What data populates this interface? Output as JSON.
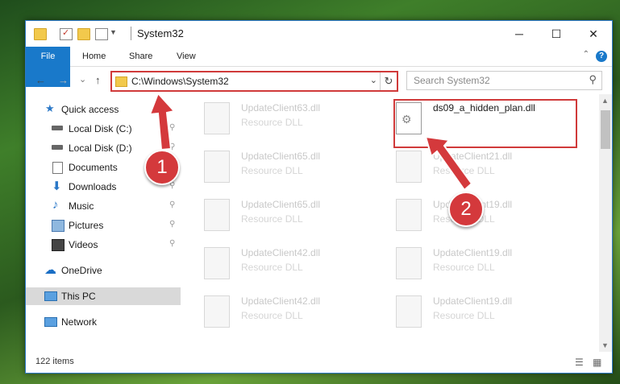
{
  "window": {
    "title": "System32",
    "minimize": "─",
    "maximize": "☐",
    "close": "✕"
  },
  "ribbon": {
    "tabs": [
      "File",
      "Home",
      "Share",
      "View"
    ],
    "help": "?",
    "collapse": "⌃"
  },
  "nav": {
    "back": "←",
    "forward": "→",
    "recent": "⌄",
    "up": "↑",
    "address": "C:\\Windows\\System32",
    "dropdown": "⌄",
    "refresh": "↻",
    "search_placeholder": "Search System32",
    "search_icon": "⚲"
  },
  "sidebar": {
    "items": [
      {
        "label": "Quick access",
        "icon": "star-icon",
        "pinned": false
      },
      {
        "label": "Local Disk (C:)",
        "icon": "drive-icon",
        "pinned": true
      },
      {
        "label": "Local Disk (D:)",
        "icon": "drive-icon",
        "pinned": true
      },
      {
        "label": "Documents",
        "icon": "document-icon",
        "pinned": true
      },
      {
        "label": "Downloads",
        "icon": "download-icon",
        "pinned": true
      },
      {
        "label": "Music",
        "icon": "music-icon",
        "pinned": true
      },
      {
        "label": "Pictures",
        "icon": "pictures-icon",
        "pinned": true
      },
      {
        "label": "Videos",
        "icon": "videos-icon",
        "pinned": true
      },
      {
        "label": "OneDrive",
        "icon": "cloud-icon",
        "pinned": false
      },
      {
        "label": "This PC",
        "icon": "computer-icon",
        "pinned": false
      },
      {
        "label": "Network",
        "icon": "network-icon",
        "pinned": false
      }
    ],
    "pin_glyph": "📌"
  },
  "files": [
    {
      "name": "UpdateClient63.dll",
      "type": "Resource DLL"
    },
    {
      "name": "ds09_a_hidden_plan.dll",
      "type": ""
    },
    {
      "name": "UpdateClient65.dll",
      "type": "Resource DLL"
    },
    {
      "name": "UpdateClient21.dll",
      "type": "Resource DLL"
    },
    {
      "name": "UpdateClient65.dll",
      "type": "Resource DLL"
    },
    {
      "name": "UpdateClient19.dll",
      "type": "Resource DLL"
    },
    {
      "name": "UpdateClient42.dll",
      "type": "Resource DLL"
    },
    {
      "name": "UpdateClient19.dll",
      "type": "Resource DLL"
    },
    {
      "name": "UpdateClient42.dll",
      "type": "Resource DLL"
    },
    {
      "name": "UpdateClient19.dll",
      "type": "Resource DLL"
    }
  ],
  "status": {
    "item_count": "122 items"
  },
  "annotations": {
    "step1": "1",
    "step2": "2",
    "color": "#d4393c"
  }
}
